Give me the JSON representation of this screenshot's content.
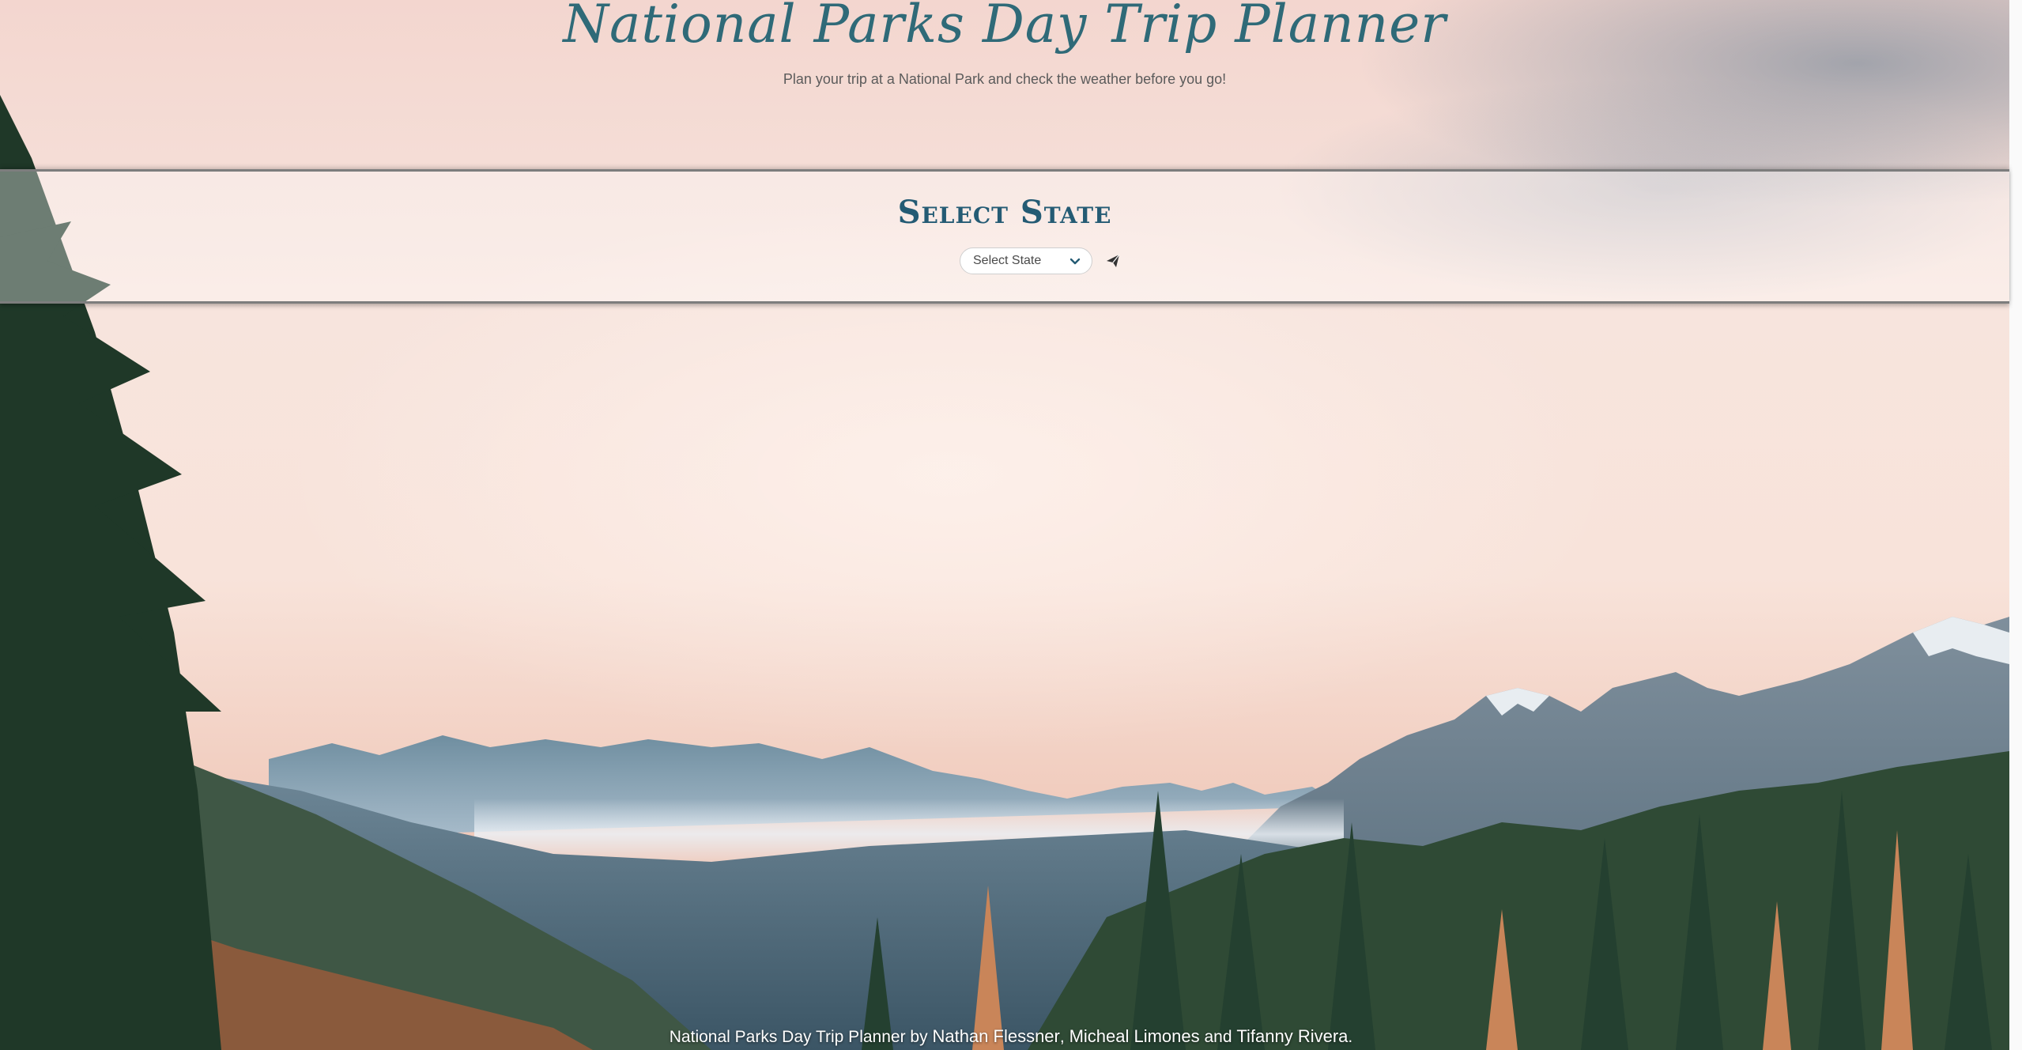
{
  "header": {
    "title": "National Parks Day Trip Planner",
    "subtitle": "Plan your trip at a National Park and check the weather before you go!"
  },
  "state_selector": {
    "heading": "Select State",
    "select_value": "Select State",
    "dropdown_icon": "chevron-down-icon",
    "submit_icon": "paper-plane-icon"
  },
  "footer": {
    "app_name": "National Parks Day Trip Planner",
    "by": "by",
    "author1": "Nathan Flessner",
    "separator": ",",
    "author2": "Micheal Limones",
    "and": "and",
    "author3": "Tifanny Rivera",
    "end": "."
  },
  "colors": {
    "title": "#2f6a78",
    "heading": "#245b74",
    "panel_border": "#7d7d7d"
  }
}
